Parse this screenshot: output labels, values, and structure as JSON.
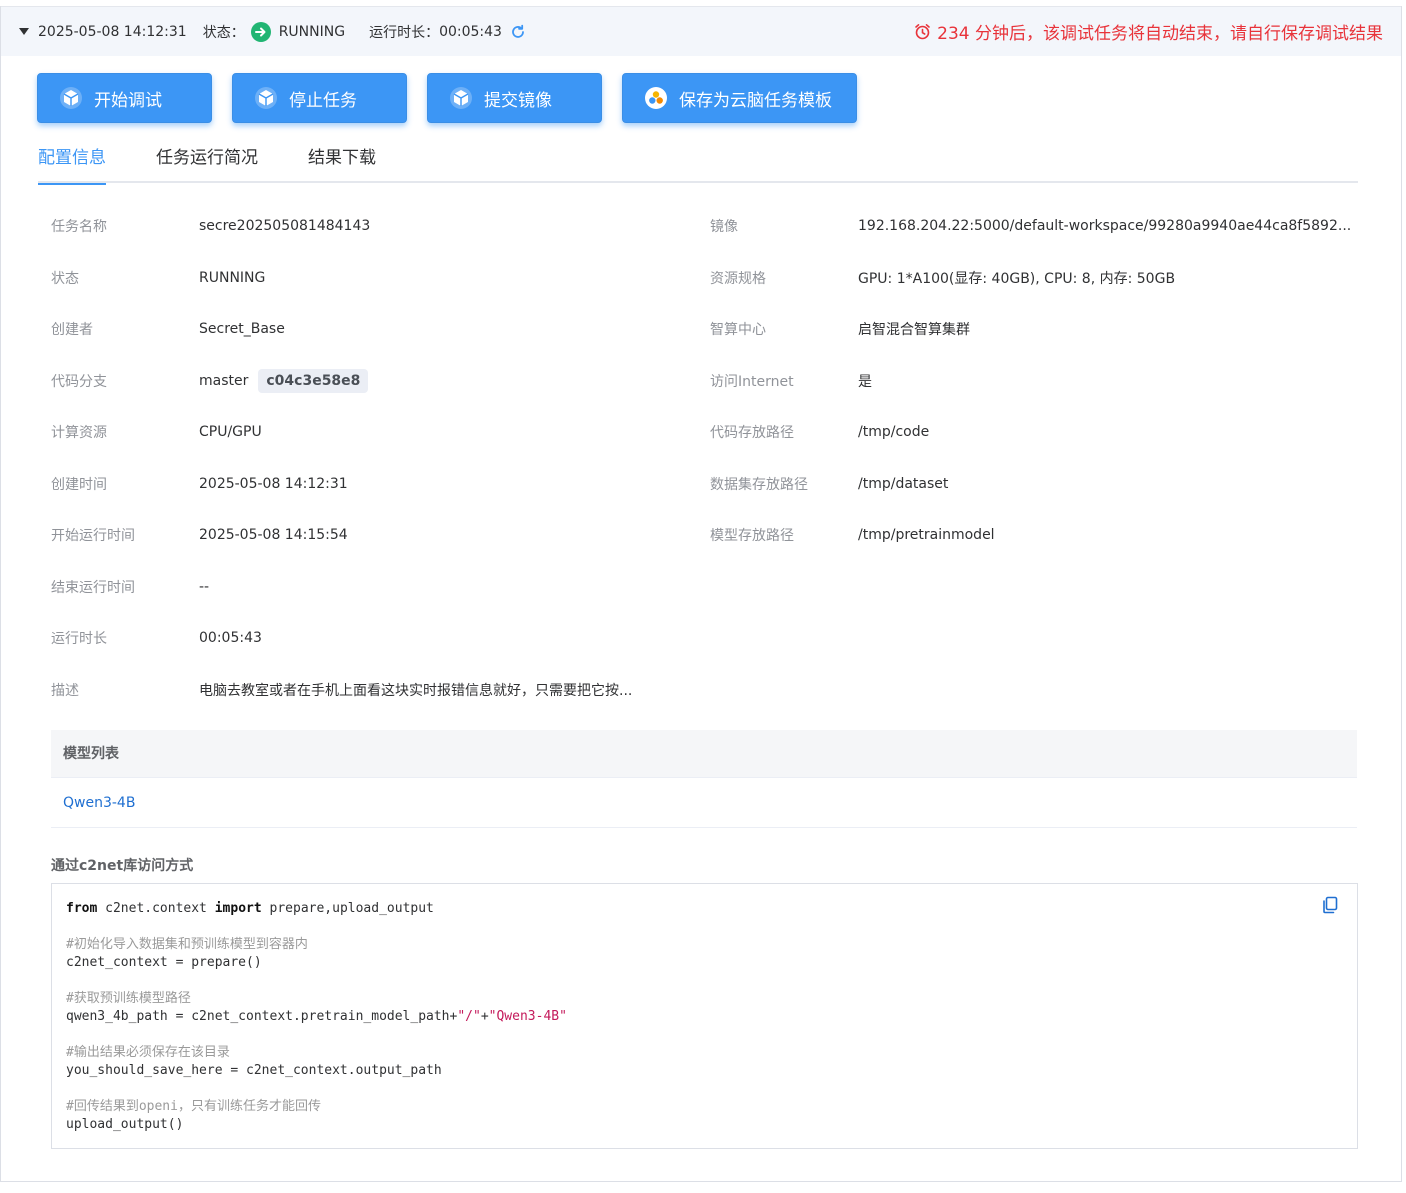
{
  "topbar": {
    "datetime": "2025-05-08 14:12:31",
    "status_label": "状态：",
    "status_value": "RUNNING",
    "duration_label": "运行时长：",
    "duration_value": "00:05:43",
    "warning": "234 分钟后，该调试任务将自动结束，请自行保存调试结果"
  },
  "toolbar": {
    "start": "开始调试",
    "stop": "停止任务",
    "commit": "提交镜像",
    "save_template": "保存为云脑任务模板"
  },
  "tabs": [
    "配置信息",
    "任务运行简况",
    "结果下载"
  ],
  "info_left": [
    {
      "label": "任务名称",
      "value": "secre202505081484143"
    },
    {
      "label": "状态",
      "value": "RUNNING"
    },
    {
      "label": "创建者",
      "value": "Secret_Base"
    },
    {
      "label": "代码分支",
      "value": "master",
      "hash": "c04c3e58e8"
    },
    {
      "label": "计算资源",
      "value": "CPU/GPU"
    },
    {
      "label": "创建时间",
      "value": "2025-05-08 14:12:31"
    },
    {
      "label": "开始运行时间",
      "value": "2025-05-08 14:15:54"
    },
    {
      "label": "结束运行时间",
      "value": "--"
    },
    {
      "label": "运行时长",
      "value": "00:05:43"
    },
    {
      "label": "描述",
      "value": "电脑去教室或者在手机上面看这块实时报错信息就好，只需要把它按..."
    }
  ],
  "info_right": [
    {
      "label": "镜像",
      "value": "192.168.204.22:5000/default-workspace/99280a9940ae44ca8f5892..."
    },
    {
      "label": "资源规格",
      "value": "GPU: 1*A100(显存: 40GB), CPU: 8, 内存: 50GB"
    },
    {
      "label": "智算中心",
      "value": "启智混合智算集群"
    },
    {
      "label": "访问Internet",
      "value": "是"
    },
    {
      "label": "代码存放路径",
      "value": "/tmp/code"
    },
    {
      "label": "数据集存放路径",
      "value": "/tmp/dataset"
    },
    {
      "label": "模型存放路径",
      "value": "/tmp/pretrainmodel"
    }
  ],
  "models": {
    "header": "模型列表",
    "items": [
      "Qwen3-4B"
    ]
  },
  "c2net": {
    "title": "通过c2net库访问方式",
    "code": {
      "l1_kw1": "from",
      "l1_mid": " c2net.context ",
      "l1_kw2": "import",
      "l1_rest": " prepare,upload_output",
      "c1": "#初始化导入数据集和预训练模型到容器内",
      "l2": "c2net_context = prepare()",
      "c2": "#获取预训练模型路径",
      "l3_a": "qwen3_4b_path = c2net_context.pretrain_model_path+",
      "l3_s1": "\"/\"",
      "l3_plus": "+",
      "l3_s2": "\"Qwen3-4B\"",
      "c3": "#输出结果必须保存在该目录",
      "l4": "you_should_save_here = c2net_context.output_path",
      "c4": "#回传结果到openi，只有训练任务才能回传",
      "l5": "upload_output()"
    }
  },
  "colors": {
    "primary": "#3c96f5",
    "running": "#21b573",
    "warning": "#e8333a",
    "link": "#1f6fd1"
  }
}
